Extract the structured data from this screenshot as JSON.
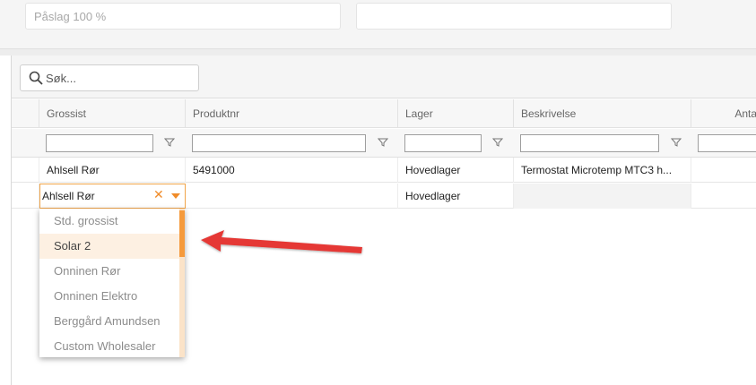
{
  "top": {
    "markup_value": "Påslag 100 %",
    "second_value": ""
  },
  "search": {
    "text": "Søk..."
  },
  "columns": [
    "Grossist",
    "Produktnr",
    "Lager",
    "Beskrivelse",
    "Anta"
  ],
  "rows": [
    {
      "grossist": "Ahlsell Rør",
      "produktnr": "5491000",
      "lager": "Hovedlager",
      "beskrivelse": "Termostat Microtemp MTC3 h..."
    },
    {
      "grossist": "",
      "produktnr": "",
      "lager": "Hovedlager",
      "beskrivelse": ""
    }
  ],
  "editor": {
    "value": "Ahlsell Rør",
    "clear_symbol": "✕"
  },
  "dropdown": {
    "options": [
      "Std. grossist",
      "Solar 2",
      "Onninen Rør",
      "Onninen Elektro",
      "Berggård Amundsen",
      "Custom Wholesaler"
    ],
    "selected": "Solar 2"
  },
  "colors": {
    "accent": "#f59a3c",
    "annotation_arrow": "#e53935"
  }
}
